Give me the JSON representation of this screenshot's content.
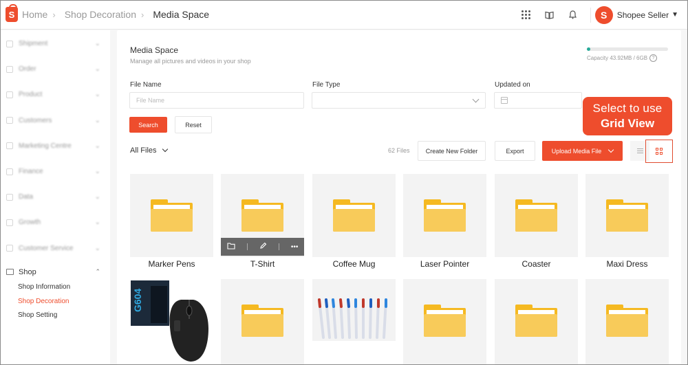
{
  "breadcrumb": {
    "home": "Home",
    "parent": "Shop Decoration",
    "current": "Media Space"
  },
  "topbar": {
    "seller_name": "Shopee Seller",
    "avatar_letter": "S",
    "logo_letter": "S"
  },
  "sidebar": {
    "items": [
      {
        "label": "Shipment"
      },
      {
        "label": "Order"
      },
      {
        "label": "Product"
      },
      {
        "label": "Customers"
      },
      {
        "label": "Marketing Centre"
      },
      {
        "label": "Finance"
      },
      {
        "label": "Data"
      },
      {
        "label": "Growth"
      },
      {
        "label": "Customer Service"
      }
    ],
    "shop": {
      "label": "Shop",
      "sub_items": [
        {
          "label": "Shop Information"
        },
        {
          "label": "Shop Decoration"
        },
        {
          "label": "Shop Setting"
        }
      ]
    }
  },
  "media": {
    "title": "Media Space",
    "subtitle": "Manage all pictures and videos in your shop",
    "capacity_text": "Capacity 43.92MB / 6GB",
    "capacity_fraction": 0.007
  },
  "filters": {
    "file_name_label": "File Name",
    "file_name_placeholder": "File Name",
    "file_type_label": "File Type",
    "updated_on_label": "Updated on",
    "search_label": "Search",
    "reset_label": "Reset"
  },
  "toolbar": {
    "all_files_label": "All Files",
    "file_count": "62 Files",
    "new_folder_label": "Create New Folder",
    "export_label": "Export",
    "upload_label": "Upload Media File"
  },
  "callout": {
    "line1": "Select to use",
    "line2": "Grid View"
  },
  "tiles": [
    {
      "name": "Marker Pens"
    },
    {
      "name": "T-Shirt"
    },
    {
      "name": "Coffee Mug"
    },
    {
      "name": "Laser Pointer"
    },
    {
      "name": "Coaster"
    },
    {
      "name": "Maxi Dress"
    }
  ],
  "colors": {
    "accent": "#ee4d2d",
    "folder": "#f5b921",
    "capacity": "#26aa99"
  }
}
